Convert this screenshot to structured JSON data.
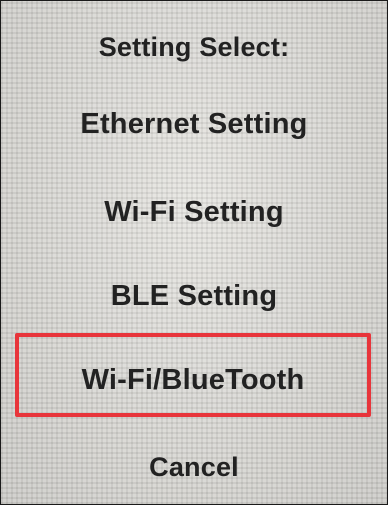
{
  "screen": {
    "title": "Setting Select:",
    "options": [
      {
        "label": "Ethernet Setting"
      },
      {
        "label": "Wi-Fi Setting"
      },
      {
        "label": "BLE Setting"
      },
      {
        "label": "Wi-Fi/BlueTooth",
        "highlighted": true
      }
    ],
    "cancel_label": "Cancel"
  },
  "colors": {
    "highlight_border": "#e8353b",
    "text": "#222222",
    "background": "#d9d8d4"
  }
}
